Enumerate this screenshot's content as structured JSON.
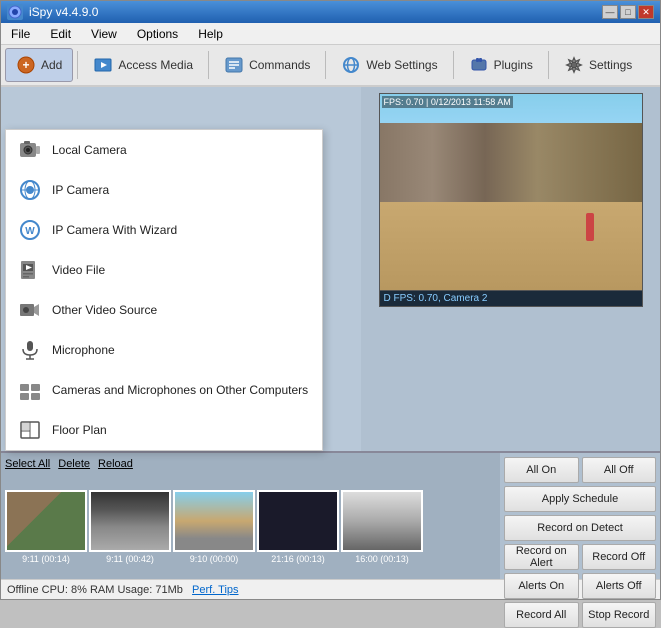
{
  "window": {
    "title": "iSpy v4.4.9.0",
    "controls": [
      "minimize",
      "maximize",
      "close"
    ]
  },
  "menu": {
    "items": [
      "File",
      "Edit",
      "View",
      "Options",
      "Help"
    ]
  },
  "toolbar": {
    "buttons": [
      {
        "id": "add",
        "label": "Add",
        "icon": "➕"
      },
      {
        "id": "access-media",
        "label": "Access Media",
        "icon": "📁"
      },
      {
        "id": "commands",
        "label": "Commands",
        "icon": "📋"
      },
      {
        "id": "web-settings",
        "label": "Web Settings",
        "icon": "🌐"
      },
      {
        "id": "plugins",
        "label": "Plugins",
        "icon": "🔌"
      },
      {
        "id": "settings",
        "label": "Settings",
        "icon": "⚙"
      }
    ]
  },
  "dropdown": {
    "items": [
      {
        "id": "local-camera",
        "label": "Local Camera"
      },
      {
        "id": "ip-camera",
        "label": "IP Camera"
      },
      {
        "id": "ip-camera-wizard",
        "label": "IP Camera With Wizard"
      },
      {
        "id": "video-file",
        "label": "Video File"
      },
      {
        "id": "other-video",
        "label": "Other Video Source"
      },
      {
        "id": "microphone",
        "label": "Microphone"
      },
      {
        "id": "cameras-other",
        "label": "Cameras and Microphones on Other Computers"
      },
      {
        "id": "floor-plan",
        "label": "Floor Plan"
      }
    ]
  },
  "camera": {
    "overlay": "FPS: 0.70 | 0/12/2013 11:58 AM",
    "status": "D  FPS: 0.70, Camera 2"
  },
  "thumbnails": [
    {
      "label": "9:11 (00:14)",
      "scene": "ts1"
    },
    {
      "label": "9:11 (00:42)",
      "scene": "ts2"
    },
    {
      "label": "9:10 (00:00)",
      "scene": "ts3"
    },
    {
      "label": "21:16 (00:13)",
      "scene": "ts4"
    },
    {
      "label": "16:00 (00:13)",
      "scene": "ts5"
    }
  ],
  "thumb_controls": [
    "Select All",
    "Delete",
    "Reload"
  ],
  "control_buttons": [
    [
      {
        "label": "All On"
      },
      {
        "label": "All Off"
      }
    ],
    [
      {
        "label": "Apply Schedule"
      }
    ],
    [
      {
        "label": "Record on Detect"
      }
    ],
    [
      {
        "label": "Record on Alert"
      },
      {
        "label": "Record Off"
      }
    ],
    [
      {
        "label": "Alerts On"
      },
      {
        "label": "Alerts Off"
      }
    ],
    [
      {
        "label": "Record All"
      },
      {
        "label": "Stop Record"
      }
    ]
  ],
  "status": {
    "text": "Offline  CPU: 8% RAM Usage: 71Mb",
    "link": "Perf. Tips",
    "right": "..."
  }
}
